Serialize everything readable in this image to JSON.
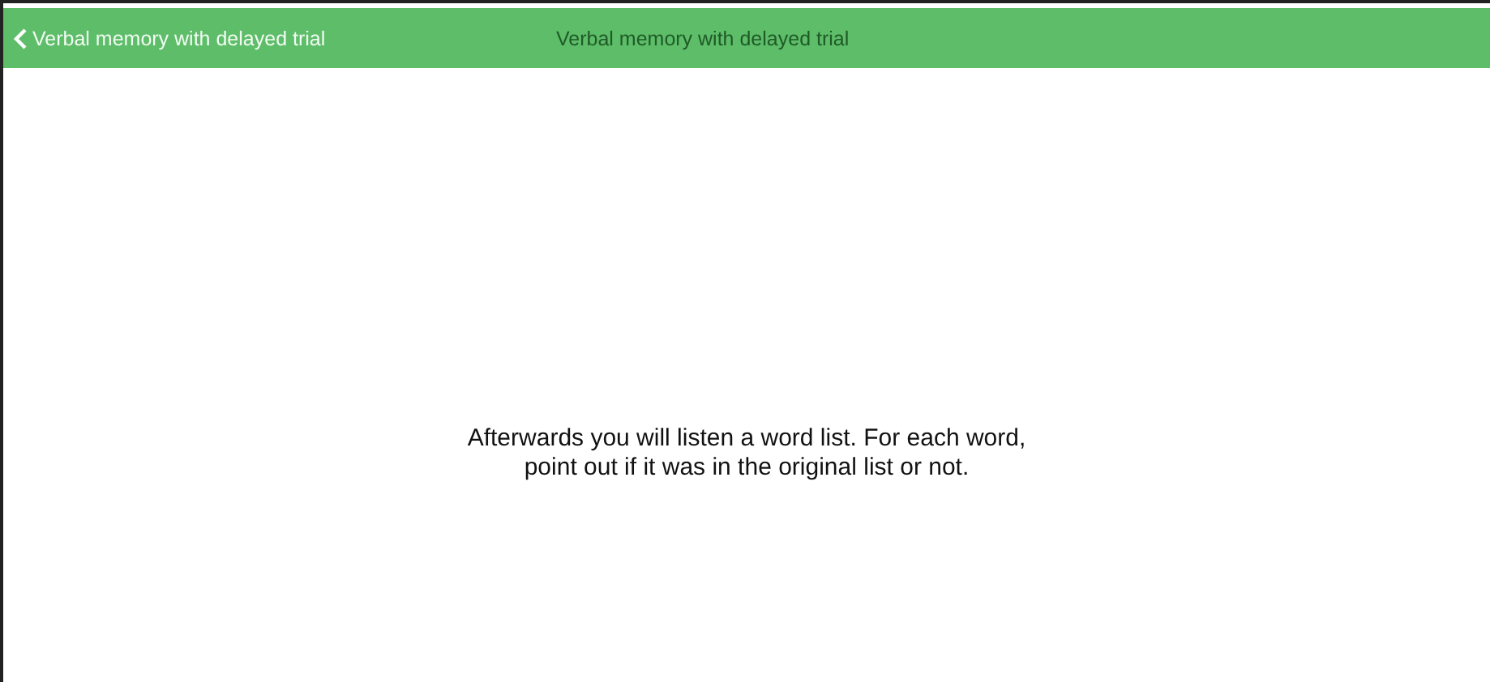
{
  "nav_bar": {
    "back_label": "Verbal memory with delayed trial",
    "title": "Verbal memory with delayed trial"
  },
  "instruction": "Afterwards you will listen a word list. For each word,\npoint out if it was in the original list or not."
}
